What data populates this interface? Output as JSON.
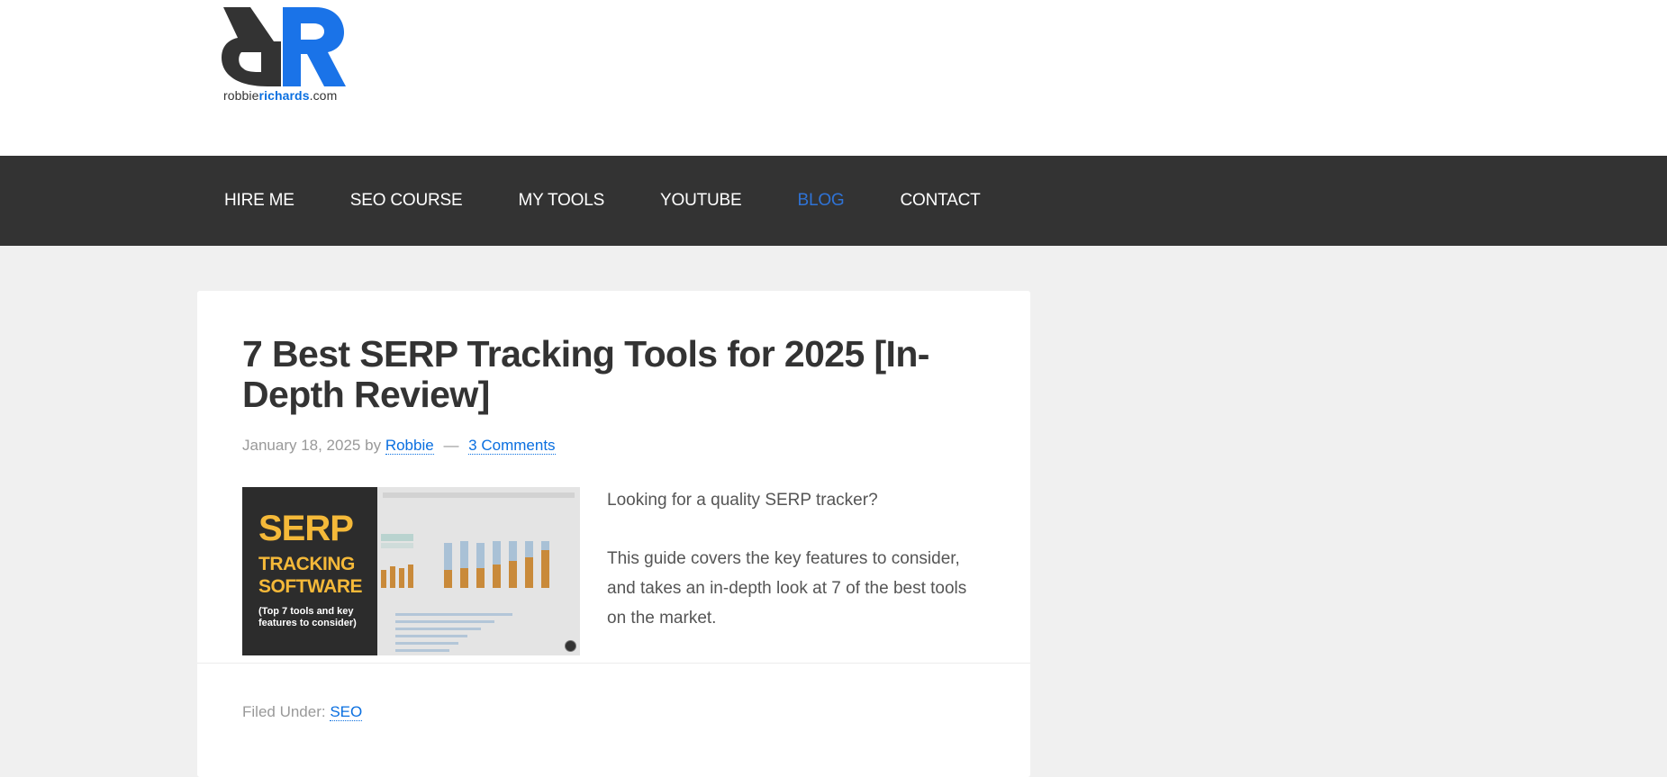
{
  "logo": {
    "text_prefix": "robbie",
    "text_highlight": "richards",
    "text_suffix": ".com",
    "colors": {
      "dark": "#333333",
      "blue": "#1a73e8"
    }
  },
  "nav": {
    "items": [
      {
        "label": "HIRE ME"
      },
      {
        "label": "SEO COURSE"
      },
      {
        "label": "MY TOOLS"
      },
      {
        "label": "YOUTUBE"
      },
      {
        "label": "BLOG",
        "active": true
      },
      {
        "label": "CONTACT"
      }
    ],
    "active_color": "#2f73d6"
  },
  "post": {
    "title": "7 Best SERP Tracking Tools for 2025 [In-Depth Review]",
    "date": "January 18, 2025",
    "by": "by",
    "author": "Robbie",
    "separator": "—",
    "comments": "3 Comments",
    "thumbnail": {
      "line1": "SERP",
      "line2": "TRACKING",
      "line3": "SOFTWARE",
      "line4": "(Top 7 tools and key features to consider)",
      "camera_icon": "camera-icon"
    },
    "excerpt": [
      "Looking for a quality SERP tracker?",
      "This guide covers the key features to consider, and takes an in-depth look at 7 of the best tools on the market."
    ],
    "filed_under_label": "Filed Under:",
    "category": "SEO"
  }
}
